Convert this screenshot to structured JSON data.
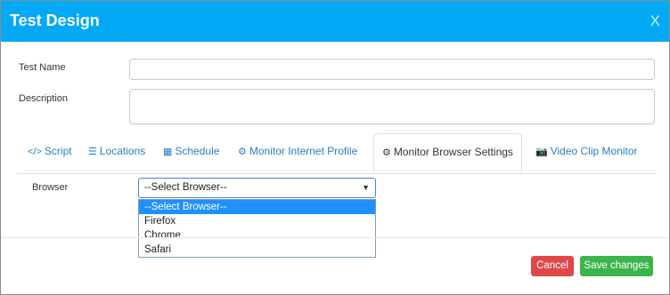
{
  "dialog": {
    "title": "Test Design",
    "close_label": "X"
  },
  "form": {
    "test_name_label": "Test Name",
    "test_name_value": "",
    "description_label": "Description",
    "description_value": ""
  },
  "tabs": [
    {
      "icon": "</>",
      "icon_name": "code-icon",
      "label": "Script",
      "active": false
    },
    {
      "icon": "☰",
      "icon_name": "sliders-icon",
      "label": "Locations",
      "active": false
    },
    {
      "icon": "▦",
      "icon_name": "calendar-icon",
      "label": "Schedule",
      "active": false
    },
    {
      "icon": "⚙",
      "icon_name": "gear-icon",
      "label": "Monitor Internet Profile",
      "active": false
    },
    {
      "icon": "⚙",
      "icon_name": "gears-icon",
      "label": "Monitor Browser Settings",
      "active": true
    },
    {
      "icon": "📷",
      "icon_name": "camera-icon",
      "label": "Video Clip Monitor",
      "active": false
    }
  ],
  "browser": {
    "label": "Browser",
    "selected": "--Select Browser--",
    "arrow": "▼",
    "options": [
      "--Select Browser--",
      "Firefox",
      "Chrome",
      "Safari"
    ]
  },
  "footer": {
    "cancel_label": "Cancel",
    "save_label": "Save changes"
  },
  "colors": {
    "header": "#03a9f4",
    "cancel": "#e04848",
    "save": "#3cb44b",
    "highlight": "#1e90ff"
  }
}
